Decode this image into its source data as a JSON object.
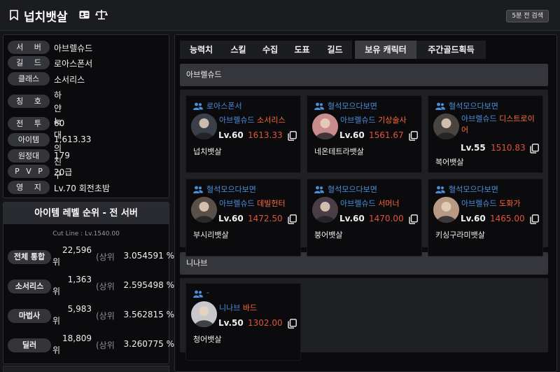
{
  "header": {
    "title": "넙치뱃살",
    "refresh_label": "5분 전 검색"
  },
  "profile": [
    {
      "label": "서 버",
      "value": "아브렐슈드"
    },
    {
      "label": "길 드",
      "value": "로아스폰서"
    },
    {
      "label": "클래스",
      "value": "소서리스"
    },
    {
      "label": "칭 호",
      "value": "하얀 늑대\n의 친구"
    },
    {
      "label": "전 투",
      "value": "60"
    },
    {
      "label": "아이템",
      "value": "1,613.33"
    },
    {
      "label": "원정대",
      "value": "179"
    },
    {
      "label": "P V P",
      "value": "20급"
    },
    {
      "label": "영 지",
      "value": "Lv.70 회전초밤"
    }
  ],
  "ranking": {
    "title": "아이템 레벨 순위 - 전 서버",
    "cutline": "Cut Line : Lv.1540.00",
    "tag": "(상위",
    "rows": [
      {
        "label": "전체 통합",
        "rank": "22,596",
        "unit": "위",
        "percent": "3.054591 %"
      },
      {
        "label": "소서리스",
        "rank": "1,363",
        "unit": "위",
        "percent": "2.595498 %"
      },
      {
        "label": "마법사",
        "rank": "5,983",
        "unit": "위",
        "percent": "3.562815 %"
      },
      {
        "label": "딜러",
        "rank": "18,809",
        "unit": "위",
        "percent": "3.260775 %"
      }
    ]
  },
  "tabs": [
    {
      "label": "능력치",
      "active": false
    },
    {
      "label": "스킬",
      "active": false
    },
    {
      "label": "수집",
      "active": false
    },
    {
      "label": "도표",
      "active": false
    },
    {
      "label": "길드",
      "active": false
    },
    {
      "label": "보유 캐릭터",
      "active": true
    },
    {
      "label": "주간골드획득",
      "active": false
    }
  ],
  "sections": [
    {
      "server": "아브렐슈드",
      "characters": [
        {
          "guild": "로아스폰서",
          "server": "아브렐슈드",
          "class": "소서리스",
          "level": "Lv.60",
          "item_level": "1613.33",
          "name": "넙치뱃살",
          "avatar_color": "#3a3f4a"
        },
        {
          "guild": "혈석모으다보면",
          "server": "아브렐슈드",
          "class": "기상술사",
          "level": "Lv.60",
          "item_level": "1561.67",
          "name": "네온테트라뱃살",
          "avatar_color": "#c98c8c"
        },
        {
          "guild": "혈석모으다보면",
          "server": "아브렐슈드",
          "class": "디스트로이어",
          "level": "Lv.55",
          "item_level": "1510.83",
          "name": "복어뱃살",
          "avatar_color": "#4a4440"
        },
        {
          "guild": "혈석모으다보면",
          "server": "아브렐슈드",
          "class": "데빌헌터",
          "level": "Lv.60",
          "item_level": "1472.50",
          "name": "부시리뱃살",
          "avatar_color": "#5a5048"
        },
        {
          "guild": "혈석모으다보면",
          "server": "아브렐슈드",
          "class": "서머너",
          "level": "Lv.60",
          "item_level": "1470.00",
          "name": "붕어뱃살",
          "avatar_color": "#4b3d45"
        },
        {
          "guild": "혈석모으다보면",
          "server": "아브렐슈드",
          "class": "도화가",
          "level": "Lv.60",
          "item_level": "1465.00",
          "name": "키싱구라미뱃살",
          "avatar_color": "#b89a84"
        }
      ]
    },
    {
      "server": "니나브",
      "characters": [
        {
          "guild": "-",
          "server": "니나브",
          "class": "바드",
          "level": "Lv.50",
          "item_level": "1302.00",
          "name": "청어뱃살",
          "avatar_color": "#c8c8cc"
        }
      ]
    }
  ],
  "colors": {
    "accent_blue": "#4c8fdc",
    "class_orange": "#ff6a3c",
    "item_level_red": "#e0533e"
  }
}
